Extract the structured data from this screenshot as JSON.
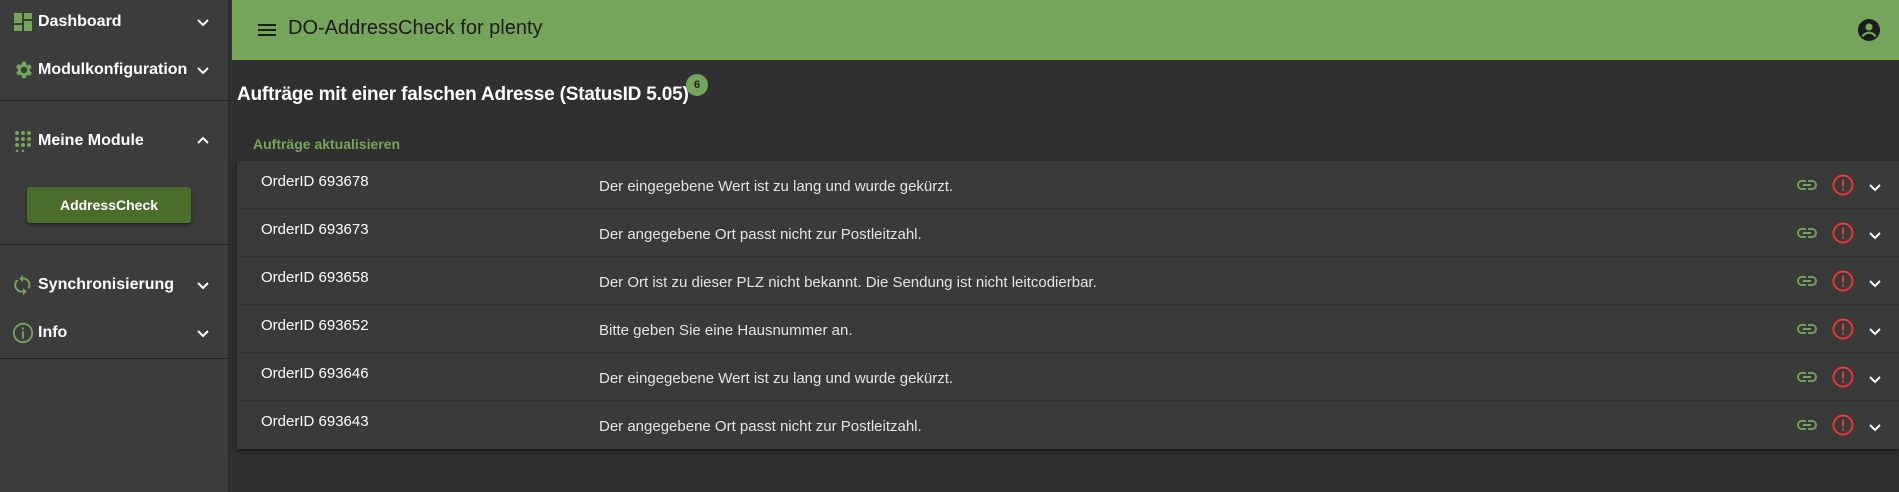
{
  "sidebar": {
    "items": [
      {
        "label": "Dashboard",
        "icon": "dashboard-icon"
      },
      {
        "label": "Modulkonfiguration",
        "icon": "gear-icon"
      },
      {
        "label": "Meine Module",
        "icon": "apps-grid-icon"
      },
      {
        "label": "Synchronisierung",
        "icon": "sync-icon"
      },
      {
        "label": "Info",
        "icon": "info-icon"
      }
    ],
    "submodule_button": "AddressCheck"
  },
  "header": {
    "title": "DO-AddressCheck for plenty"
  },
  "main": {
    "title": "Aufträge mit einer falschen Adresse (StatusID 5.05)",
    "count": "6",
    "refresh_label": "Aufträge aktualisieren",
    "orders": [
      {
        "id": "OrderID 693678",
        "message": "Der eingegebene Wert ist zu lang und wurde gekürzt."
      },
      {
        "id": "OrderID 693673",
        "message": "Der angegebene Ort passt nicht zur Postleitzahl."
      },
      {
        "id": "OrderID 693658",
        "message": "Der Ort ist zu dieser PLZ nicht bekannt. Die Sendung ist nicht leitcodierbar."
      },
      {
        "id": "OrderID 693652",
        "message": "Bitte geben Sie eine Hausnummer an."
      },
      {
        "id": "OrderID 693646",
        "message": "Der eingegebene Wert ist zu lang und wurde gekürzt."
      },
      {
        "id": "OrderID 693643",
        "message": "Der angegebene Ort passt nicht zur Postleitzahl."
      }
    ]
  },
  "colors": {
    "accent": "#74a55a",
    "header_bg": "#74a55a",
    "button_bg": "#4a6d2c",
    "alert": "#e53935",
    "background": "#303030",
    "sidebar_bg": "#3c3c3c",
    "panel_bg": "#3a3a3a"
  }
}
